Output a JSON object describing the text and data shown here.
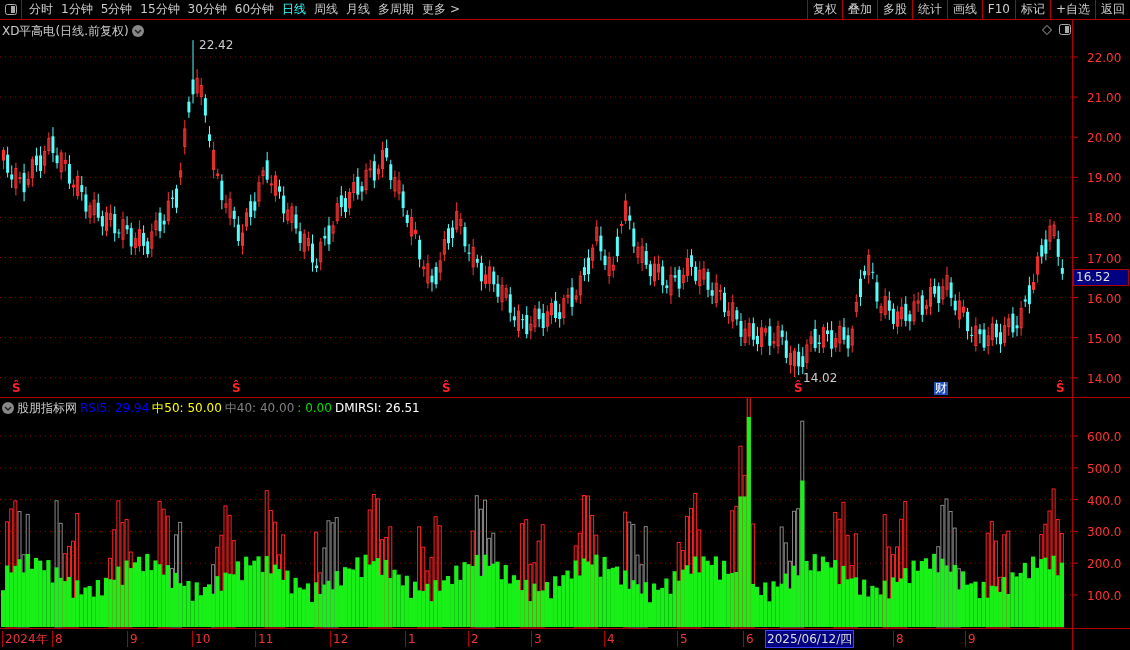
{
  "toolbar": {
    "periods": [
      {
        "label": "分时",
        "selected": false
      },
      {
        "label": "1分钟",
        "selected": false
      },
      {
        "label": "5分钟",
        "selected": false
      },
      {
        "label": "15分钟",
        "selected": false
      },
      {
        "label": "30分钟",
        "selected": false
      },
      {
        "label": "60分钟",
        "selected": false
      },
      {
        "label": "日线",
        "selected": true
      },
      {
        "label": "周线",
        "selected": false
      },
      {
        "label": "月线",
        "selected": false
      },
      {
        "label": "多周期",
        "selected": false
      },
      {
        "label": "更多 >",
        "selected": false
      }
    ],
    "actions": [
      "复权",
      "叠加",
      "多股",
      "统计",
      "画线",
      "F10",
      "标记",
      "+自选",
      "返回"
    ]
  },
  "price_chart": {
    "title": "XD平高电(日线.前复权)",
    "yticks": [
      "22.00",
      "21.00",
      "20.00",
      "19.00",
      "18.00",
      "17.00",
      "16.00",
      "15.00",
      "14.00"
    ],
    "current_price": "16.52",
    "high_label": "22.42",
    "low_label": "14.02",
    "markers": [
      {
        "kind": "event",
        "label": "Ŝ"
      },
      {
        "kind": "event",
        "label": "Ŝ"
      },
      {
        "kind": "event",
        "label": "Ŝ"
      },
      {
        "kind": "event",
        "label": "Ŝ"
      },
      {
        "kind": "finance",
        "label": "财"
      },
      {
        "kind": "event",
        "label": "Ŝ"
      }
    ]
  },
  "indicator": {
    "name": "股朋指标网",
    "legend": [
      {
        "text": "RSI5: 29.94",
        "color": "#0000ff"
      },
      {
        "text": "中50: 50.00",
        "color": "#ffff00"
      },
      {
        "text": "中40: 40.00",
        "color": "#808080"
      },
      {
        "text": ": 0.00",
        "color": "#00e000"
      },
      {
        "text": "DMIRSI: 26.51",
        "color": "#ffffff"
      }
    ],
    "yticks": [
      "600.0",
      "500.0",
      "400.0",
      "300.0",
      "200.0",
      "100.0"
    ]
  },
  "date_axis": {
    "labels": [
      "2024年",
      "8",
      "9",
      "10",
      "11",
      "12",
      "1",
      "2",
      "3",
      "4",
      "5",
      "6",
      "8",
      "9"
    ],
    "cursor_date": "2025/06/12/四"
  }
}
